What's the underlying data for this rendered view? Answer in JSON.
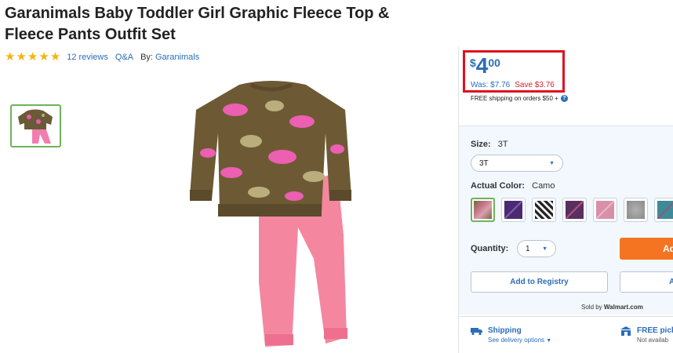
{
  "product": {
    "title_line1": "Garanimals Baby Toddler Girl Graphic Fleece Top &",
    "title_line2": "Fleece Pants Outfit Set",
    "reviews": "12 reviews",
    "qa": "Q&A",
    "by_label": "By:",
    "brand": "Garanimals",
    "rating_stars": 5
  },
  "price": {
    "currency": "$",
    "dollars": "4",
    "cents": "00",
    "was": "Was: $7.76",
    "save": "Save $3.76",
    "shipping_note": "FREE shipping on orders $50 +",
    "help": "?"
  },
  "options": {
    "size_label": "Size:",
    "size_value": "3T",
    "size_selected": "3T",
    "color_label": "Actual Color:",
    "color_value": "Camo",
    "swatches": [
      "#c97a8e",
      "#4a2a72",
      "#444444",
      "#5a2e5e",
      "#d88fa8",
      "#9a9a9a",
      "#3e8a98"
    ],
    "quantity_label": "Quantity:",
    "quantity_value": "1"
  },
  "actions": {
    "add_to_cart": "Ad",
    "add_to_registry": "Add to Registry",
    "add_to_list": "A",
    "sold_by_prefix": "Sold by",
    "sold_by": "Walmart.com"
  },
  "fulfillment": {
    "shipping_title": "Shipping",
    "shipping_sub": "See delivery options",
    "pickup_title": "FREE pick",
    "pickup_sub": "Not availab"
  },
  "colors": {
    "accent": "#2a6ebb",
    "cart": "#f47421",
    "highlight_box": "#e0101f",
    "save": "#d6212e"
  }
}
